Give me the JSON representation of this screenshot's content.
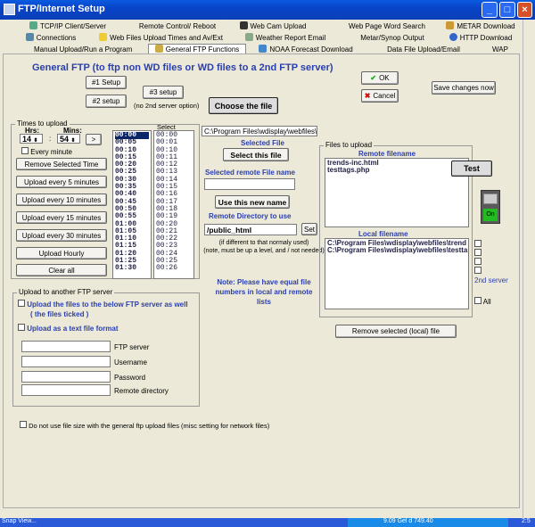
{
  "window": {
    "title": "FTP/Internet Setup",
    "minimize": "_",
    "maximize": "□",
    "close": "×"
  },
  "tabs_row1": [
    {
      "label": "TCP/IP Client/Server",
      "icon": "network-icon"
    },
    {
      "label": "Remote Control/ Reboot",
      "icon": ""
    },
    {
      "label": "Web Cam Upload",
      "icon": "camera-icon"
    },
    {
      "label": "Web Page Word Search",
      "icon": ""
    },
    {
      "label": "METAR Download",
      "icon": "arrow-icon"
    }
  ],
  "tabs_row2": [
    {
      "label": "Connections",
      "icon": "network-icon"
    },
    {
      "label": "Web Files Upload Times and Av/Ext",
      "icon": "clock-icon"
    },
    {
      "label": "Weather Report Email",
      "icon": "mail-icon"
    },
    {
      "label": "Metar/Synop Output",
      "icon": ""
    },
    {
      "label": "HTTP Download",
      "icon": "globe-icon"
    }
  ],
  "tabs_row3": [
    {
      "label": "Manual Upload/Run a Program",
      "icon": ""
    },
    {
      "label": "General FTP Functions",
      "icon": "ftp-icon"
    },
    {
      "label": "NOAA Forecast Download",
      "icon": "noaa-icon"
    },
    {
      "label": "Data File Upload/Email",
      "icon": ""
    },
    {
      "label": "WAP",
      "icon": ""
    }
  ],
  "heading": "General FTP (to ftp non WD files or WD files to a 2nd FTP server)",
  "buttons": {
    "setup1": "#1 Setup",
    "setup2": "#2 setup",
    "setup3": "#3 setup",
    "setup3_note": "(no 2nd server option)",
    "choose_file": "Choose the file",
    "ok": "OK",
    "cancel": "Cancel",
    "save_changes": "Save changes now",
    "test": "Test",
    "on": "On",
    "select_file": "Select this file",
    "use_name": "Use this new name",
    "set": "Set",
    "remove_local": "Remove selected (local) file"
  },
  "times": {
    "title": "Times to upload",
    "hrs_label": "Hrs:",
    "mins_label": "Mins:",
    "hrs_value": "14",
    "mins_value": "54",
    "colon": ":",
    "arrow": ">",
    "every_minute": "Every minute",
    "select_label": "Select",
    "buttons": [
      "Remove Selected Time",
      "Upload every 5 minutes",
      "Upload every 10 minutes",
      "Upload every 15 minutes",
      "Upload every 30 minutes",
      "Upload Hourly",
      "Clear all"
    ],
    "list_a": [
      "00:00",
      "00:05",
      "00:10",
      "00:15",
      "00:20",
      "00:25",
      "00:30",
      "00:35",
      "00:40",
      "00:45",
      "00:50",
      "00:55",
      "01:00",
      "01:05",
      "01:10",
      "01:15",
      "01:20",
      "01:25",
      "01:30"
    ],
    "list_b": [
      "00:00",
      "00:01",
      "00:10",
      "00:11",
      "00:12",
      "00:13",
      "00:14",
      "00:15",
      "00:16",
      "00:17",
      "00:18",
      "00:19",
      "00:20",
      "00:21",
      "00:22",
      "00:23",
      "00:24",
      "00:25",
      "00:26"
    ]
  },
  "file_path": "C:\\Program Files\\wdisplay\\webfiles\\testt",
  "selected_file_label": "Selected File",
  "selected_remote_label": "Selected remote File name",
  "remote_filename_value": "",
  "remote_dir_label": "Remote Directory to use",
  "remote_dir_value": "/public_html",
  "remote_dir_note": "(if different to that normaly used)\n(note, must be up a level, and / not needed)",
  "note": "Note: Please have equal file numbers in local and remote lists",
  "files_to_upload": {
    "title": "Files to upload",
    "remote_header": "Remote filename",
    "remote_files": [
      "trends-inc.html",
      "testtags.php"
    ],
    "local_header": "Local filename",
    "local_files": [
      "C:\\Program Files\\wdisplay\\webfiles\\trend",
      "C:\\Program Files\\wdisplay\\webfiles\\testta"
    ]
  },
  "second_server": "2nd server",
  "all_label": "All",
  "another_ftp": {
    "title": "Upload to another FTP server",
    "opt1": "Upload the files to the below FTP server as well",
    "opt1b": "( the files ticked )",
    "opt2": "Upload as a text file format",
    "fields": [
      "FTP server",
      "Username",
      "Password",
      "Remote directory"
    ]
  },
  "bottom_option": "Do not use file size with the general ftp upload files (misc setting for network files)",
  "taskbar": {
    "left": "Snap View...",
    "right": "9.09 Gel d 749.40",
    "clock": "2:5"
  },
  "colors": {
    "accent": "#2a3fb0",
    "title": "#0a4fd8",
    "on": "#22bb22"
  }
}
